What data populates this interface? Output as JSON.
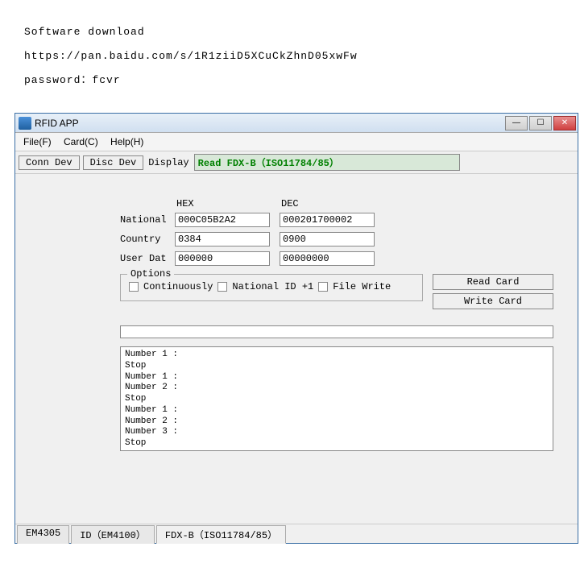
{
  "top": {
    "line1": "Software download",
    "line2": "https://pan.baidu.com/s/1R1ziiD5XCuCkZhnD05xwFw",
    "line3": "password：fcvr"
  },
  "window": {
    "title": "RFID APP"
  },
  "menu": {
    "file": "File(F)",
    "card": "Card(C)",
    "help": "Help(H)"
  },
  "toolbar": {
    "conn": "Conn Dev",
    "disc": "Disc Dev",
    "display_label": "Display",
    "display_value": "Read FDX-B（ISO11784/85）"
  },
  "fields": {
    "hex_label": "HEX",
    "dec_label": "DEC",
    "national_label": "National",
    "national_hex": "000C05B2A2",
    "national_dec": "000201700002",
    "country_label": "Country",
    "country_hex": "0384",
    "country_dec": "0900",
    "userdat_label": "User Dat",
    "userdat_hex": "000000",
    "userdat_dec": "00000000"
  },
  "options": {
    "legend": "Options",
    "continuously": "Continuously",
    "national_id_plus1": "National ID +1",
    "file_write": "File Write"
  },
  "actions": {
    "read": "Read Card",
    "write": "Write Card"
  },
  "log": "Number 1 :\nStop\nNumber 1 :\nNumber 2 :\nStop\nNumber 1 :\nNumber 2 :\nNumber 3 :\nStop",
  "tabs": {
    "em4305": "EM4305",
    "id_em4100": "ID（EM4100）",
    "fdxb": "FDX-B（ISO11784/85）"
  }
}
